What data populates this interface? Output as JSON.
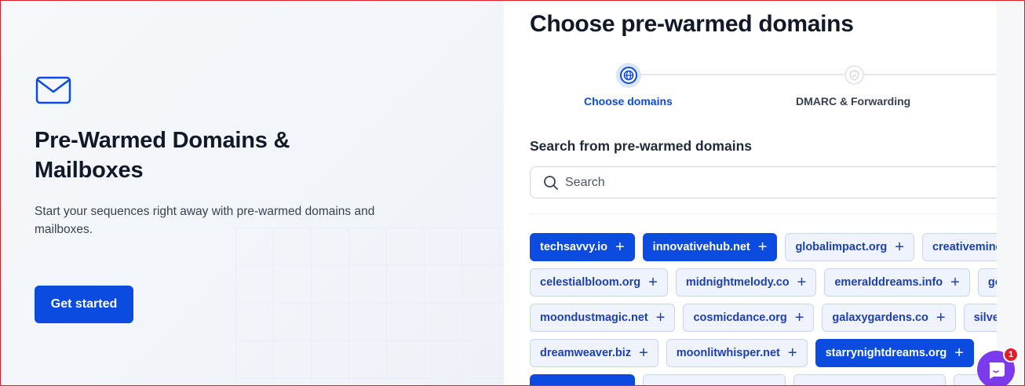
{
  "hero": {
    "title": "Pre-Warmed Domains & Mailboxes",
    "subtitle": "Start your sequences right away with pre-warmed domains and mailboxes.",
    "cta_label": "Get started",
    "icon": "mail-icon"
  },
  "panel": {
    "title": "Choose pre-warmed domains",
    "steps": [
      {
        "label": "Choose domains",
        "state": "active",
        "icon": "globe-icon"
      },
      {
        "label": "DMARC & Forwarding",
        "state": "inactive",
        "icon": "shield-icon"
      }
    ],
    "section_title": "Search from pre-warmed domains",
    "search": {
      "placeholder": "Search",
      "value": ""
    }
  },
  "domain_rows": [
    [
      {
        "label": "techsavvy.io",
        "selected": true
      },
      {
        "label": "innovativehub.net",
        "selected": true
      },
      {
        "label": "globalimpact.org",
        "selected": false
      },
      {
        "label": "creativeminc",
        "selected": false
      }
    ],
    [
      {
        "label": "celestialbloom.org",
        "selected": false
      },
      {
        "label": "midnightmelody.co",
        "selected": false
      },
      {
        "label": "emeralddreams.info",
        "selected": false
      },
      {
        "label": "go",
        "selected": false
      }
    ],
    [
      {
        "label": "moondustmagic.net",
        "selected": false
      },
      {
        "label": "cosmicdance.org",
        "selected": false
      },
      {
        "label": "galaxygardens.co",
        "selected": false
      },
      {
        "label": "silver",
        "selected": false
      }
    ],
    [
      {
        "label": "dreamweaver.biz",
        "selected": false
      },
      {
        "label": "moonlitwhisper.net",
        "selected": false
      },
      {
        "label": "starrynightdreams.org",
        "selected": true
      }
    ]
  ],
  "chat": {
    "badge_count": "1",
    "icon": "chat-icon"
  },
  "colors": {
    "accent": "#0b4be0",
    "chip_bg": "#eef3fd",
    "chat": "#7c3aed",
    "badge": "#e11d2a"
  }
}
